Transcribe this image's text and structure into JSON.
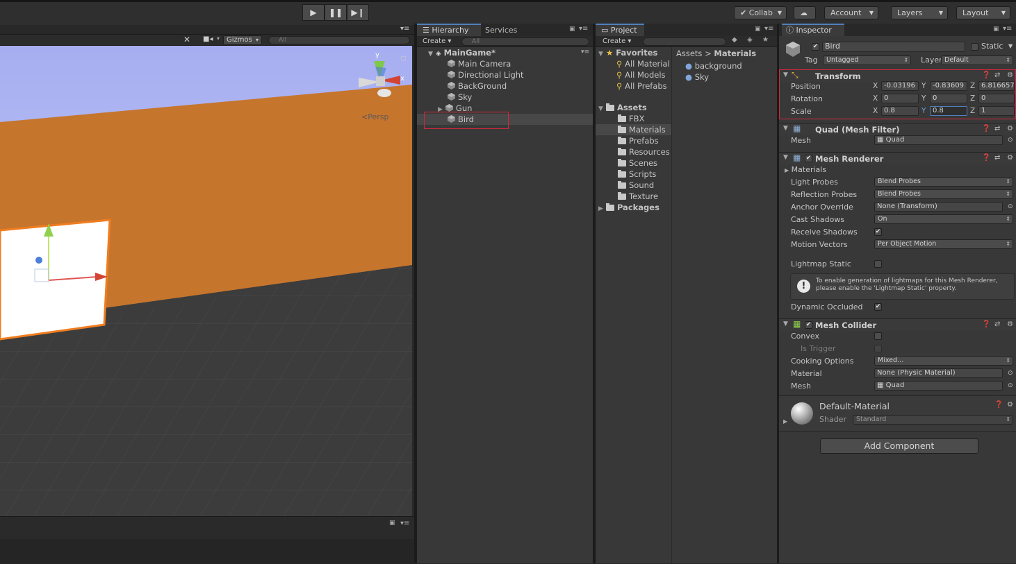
{
  "toolbar": {
    "play_icon": "play-icon",
    "pause_icon": "pause-icon",
    "step_icon": "step-icon",
    "collab": "Collab",
    "cloud_icon": "cloud-icon",
    "account": "Account",
    "layers": "Layers",
    "layout": "Layout"
  },
  "scene": {
    "gizmos": "Gizmos",
    "search_placeholder": "All",
    "persp": "Persp",
    "axis_y": "y",
    "axis_x": "x"
  },
  "hierarchy": {
    "tab": "Hierarchy",
    "services_tab": "Services",
    "create": "Create",
    "search_placeholder": "All",
    "scene_name": "MainGame*",
    "items": [
      "Main Camera",
      "Directional Light",
      "BackGround",
      "Sky",
      "Gun",
      "Bird"
    ],
    "selected": "Bird"
  },
  "project": {
    "tab": "Project",
    "create": "Create",
    "favorites": "Favorites",
    "favorite_items": [
      "All Material",
      "All Models",
      "All Prefabs"
    ],
    "assets": "Assets",
    "asset_folders": [
      "FBX",
      "Materials",
      "Prefabs",
      "Resources",
      "Scenes",
      "Scripts",
      "Sound",
      "Texture"
    ],
    "packages": "Packages",
    "breadcrumb_root": "Assets",
    "breadcrumb_sep": ">",
    "breadcrumb_current": "Materials",
    "materials": [
      "background",
      "Sky"
    ]
  },
  "inspector": {
    "tab": "Inspector",
    "object_name": "Bird",
    "static_label": "Static",
    "tag_label": "Tag",
    "tag_value": "Untagged",
    "layer_label": "Layer",
    "layer_value": "Default",
    "transform": {
      "title": "Transform",
      "position_label": "Position",
      "rotation_label": "Rotation",
      "scale_label": "Scale",
      "x": "X",
      "y": "Y",
      "z": "Z",
      "position": [
        "-0.03196",
        "-0.83609",
        "6.816657"
      ],
      "rotation": [
        "0",
        "0",
        "0"
      ],
      "scale": [
        "0.8",
        "0.8",
        "1"
      ]
    },
    "mesh_filter": {
      "title": "Quad (Mesh Filter)",
      "mesh_label": "Mesh",
      "mesh_value": "Quad"
    },
    "mesh_renderer": {
      "title": "Mesh Renderer",
      "materials_label": "Materials",
      "light_probes_label": "Light Probes",
      "light_probes_value": "Blend Probes",
      "reflection_probes_label": "Reflection Probes",
      "reflection_probes_value": "Blend Probes",
      "anchor_override_label": "Anchor Override",
      "anchor_override_value": "None (Transform)",
      "cast_shadows_label": "Cast Shadows",
      "cast_shadows_value": "On",
      "receive_shadows_label": "Receive Shadows",
      "motion_vectors_label": "Motion Vectors",
      "motion_vectors_value": "Per Object Motion",
      "lightmap_static_label": "Lightmap Static",
      "info_text": "To enable generation of lightmaps for this Mesh Renderer, please enable the 'Lightmap Static' property.",
      "dynamic_occluded_label": "Dynamic Occluded"
    },
    "mesh_collider": {
      "title": "Mesh Collider",
      "convex_label": "Convex",
      "is_trigger_label": "Is Trigger",
      "cooking_options_label": "Cooking Options",
      "cooking_options_value": "Mixed...",
      "material_label": "Material",
      "material_value": "None (Physic Material)",
      "mesh_label": "Mesh",
      "mesh_value": "Quad"
    },
    "material": {
      "name": "Default-Material",
      "shader_label": "Shader",
      "shader_value": "Standard"
    },
    "add_component": "Add Component"
  }
}
